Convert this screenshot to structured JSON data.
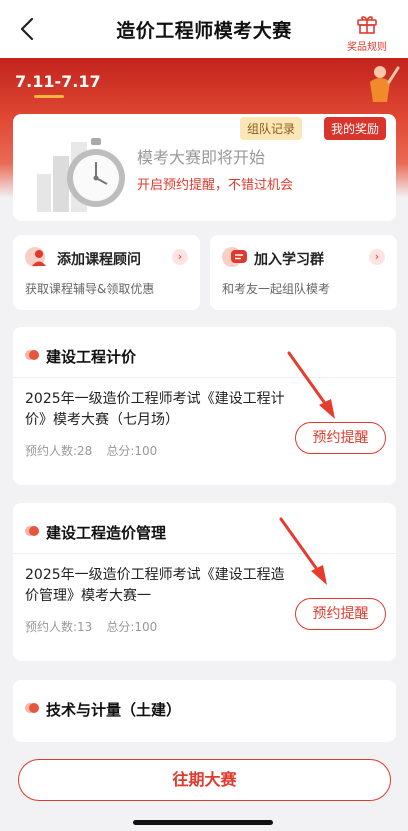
{
  "nav": {
    "title": "造价工程师模考大赛",
    "prize_rules": "奖品规则"
  },
  "hero": {
    "date_tab": "7.11-7.17"
  },
  "notice": {
    "team_record": "组队记录",
    "my_prizes": "我的奖励",
    "title": "模考大赛即将开始",
    "subtitle": "开启预约提醒，不错过机会"
  },
  "quick_links": [
    {
      "title": "添加课程顾问",
      "desc": "获取课程辅导&领取优惠"
    },
    {
      "title": "加入学习群",
      "desc": "和考友一起组队模考"
    }
  ],
  "sections": [
    {
      "title": "建设工程计价",
      "exam": "2025年一级造价工程师考试《建设工程计价》模考大赛（七月场）",
      "reservations": "预约人数:28",
      "total_score": "总分:100",
      "button": "预约提醒"
    },
    {
      "title": "建设工程造价管理",
      "exam": "2025年一级造价工程师考试《建设工程造价管理》模考大赛一",
      "reservations": "预约人数:13",
      "total_score": "总分:100",
      "button": "预约提醒"
    },
    {
      "title": "技术与计量（土建）"
    }
  ],
  "footer": {
    "past_contests": "往期大赛"
  },
  "colors": {
    "accent": "#e03a2c",
    "hero": "#c2241c",
    "badge_gold": "#fbe6b6"
  }
}
